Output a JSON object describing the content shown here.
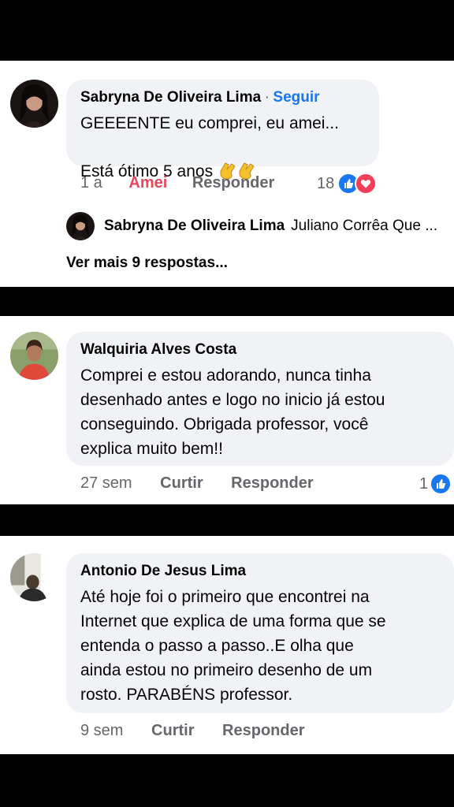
{
  "comments": [
    {
      "author": "Sabryna De Oliveira Lima",
      "separator": "·",
      "follow_label": "Seguir",
      "text": "GEEEENTE eu comprei, eu amei...\nEstá ótimo 5 anos",
      "emoji": "clapping-hands",
      "time": "1 a",
      "reaction_label": "Amei",
      "reply_label": "Responder",
      "reaction_count": "18",
      "reactions": [
        "like",
        "love"
      ],
      "reply": {
        "author": "Sabryna De Oliveira Lima",
        "text": "Juliano Corrêa Que ..."
      },
      "more_replies": "Ver mais 9 respostas..."
    },
    {
      "author": "Walquiria Alves Costa",
      "text": "Comprei e estou adorando, nunca tinha\ndesenhado antes e logo no inicio já estou\nconseguindo. Obrigada professor, você\nexplica muito bem!!",
      "time": "27 sem",
      "reaction_label": "Curtir",
      "reply_label": "Responder",
      "reaction_count": "1",
      "reactions": [
        "like"
      ]
    },
    {
      "author": "Antonio De Jesus Lima",
      "text": "Até hoje foi o primeiro que encontrei na\nInternet que explica de uma forma que se\nentenda o passo a passo..E olha que\nainda estou no primeiro desenho de um\nrosto. PARABÉNS professor.",
      "time": "9 sem",
      "reaction_label": "Curtir",
      "reply_label": "Responder"
    }
  ],
  "colors": {
    "bubble": "#f0f2f5",
    "link_blue": "#1877f2",
    "love_red": "#e8475b",
    "meta_gray": "#65676b",
    "separator_bar": "#000000"
  }
}
